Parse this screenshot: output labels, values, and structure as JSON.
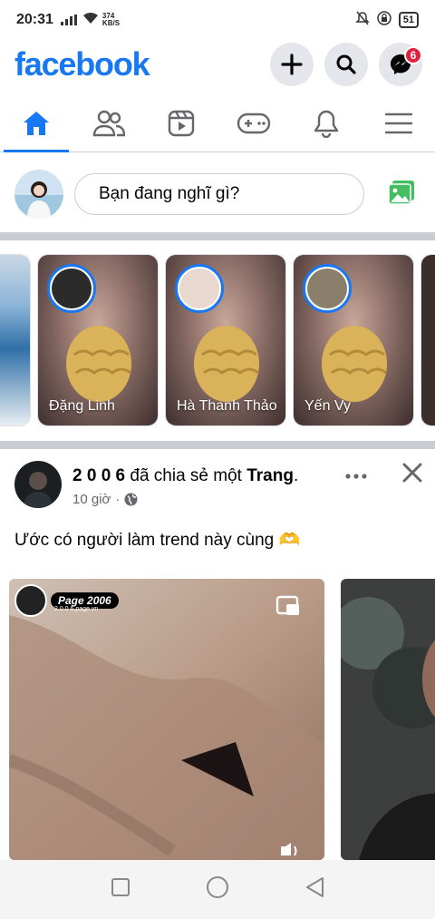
{
  "status_bar": {
    "time": "20:31",
    "speed_value": "374",
    "speed_unit": "KB/S",
    "battery": "51"
  },
  "header": {
    "logo": "facebook",
    "messenger_badge": "6"
  },
  "composer": {
    "placeholder": "Bạn đang nghĩ gì?"
  },
  "stories": [
    {
      "name": "Đặng Linh"
    },
    {
      "name": "Hà Thanh Thảo"
    },
    {
      "name": "Yến Vy"
    }
  ],
  "post": {
    "author": "2 0 0 6",
    "action": " đã chia sẻ một ",
    "target": "Trang",
    "target_suffix": ".",
    "time": "10 giờ",
    "dot": "·",
    "text": "Ước có người làm trend này cùng 🫶",
    "media_page_label": "Page 2006",
    "media_page_url": "2 0 0 6.page.vn"
  },
  "colors": {
    "brand": "#1877f2",
    "badge": "#e41e3f"
  }
}
